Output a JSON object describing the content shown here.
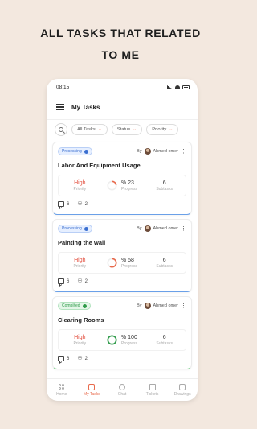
{
  "headline": {
    "line1": "ALL TASKS THAT RELATED",
    "line2": "TO ME"
  },
  "status_bar": {
    "time": "08:15"
  },
  "app_bar": {
    "title": "My Tasks"
  },
  "filters": {
    "items": [
      {
        "label": "All Tasks"
      },
      {
        "label": "Status"
      },
      {
        "label": "Priority"
      }
    ]
  },
  "tasks": [
    {
      "status": "Processing",
      "by_label": "By",
      "assignee": "Ahmed omer",
      "title": "Labor And Equipment Usage",
      "priority_value": "High",
      "priority_label": "Priority",
      "progress_value": "% 23",
      "progress_label": "Progress",
      "progress_fraction": 0.23,
      "subtasks_value": "6",
      "subtasks_label": "Subtasks",
      "comments": "6",
      "members": "2"
    },
    {
      "status": "Processing",
      "by_label": "By",
      "assignee": "Ahmed omer",
      "title": "Painting the wall",
      "priority_value": "High",
      "priority_label": "Priority",
      "progress_value": "% 58",
      "progress_label": "Progress",
      "progress_fraction": 0.58,
      "subtasks_value": "6",
      "subtasks_label": "Subtasks",
      "comments": "6",
      "members": "2"
    },
    {
      "status": "Compilted",
      "by_label": "By",
      "assignee": "Ahmed omer",
      "title": "Clearing Rooms",
      "priority_value": "High",
      "priority_label": "Priority",
      "progress_value": "% 100",
      "progress_label": "Progress",
      "progress_fraction": 1.0,
      "subtasks_value": "6",
      "subtasks_label": "Subtasks",
      "comments": "6",
      "members": "2"
    }
  ],
  "bottom_nav": {
    "items": [
      {
        "label": "Home",
        "icon": "home-grid-icon"
      },
      {
        "label": "My Tasks",
        "icon": "tasks-icon"
      },
      {
        "label": "Chat",
        "icon": "chat-icon"
      },
      {
        "label": "Tickets",
        "icon": "ticket-icon"
      },
      {
        "label": "Drawings",
        "icon": "drawings-icon"
      }
    ],
    "active": "My Tasks"
  },
  "colors": {
    "accent": "#e86a4c",
    "processing": "#3b6fd0",
    "completed": "#2d9a48",
    "priority_high": "#e24c3b",
    "background": "#f3e8df"
  }
}
